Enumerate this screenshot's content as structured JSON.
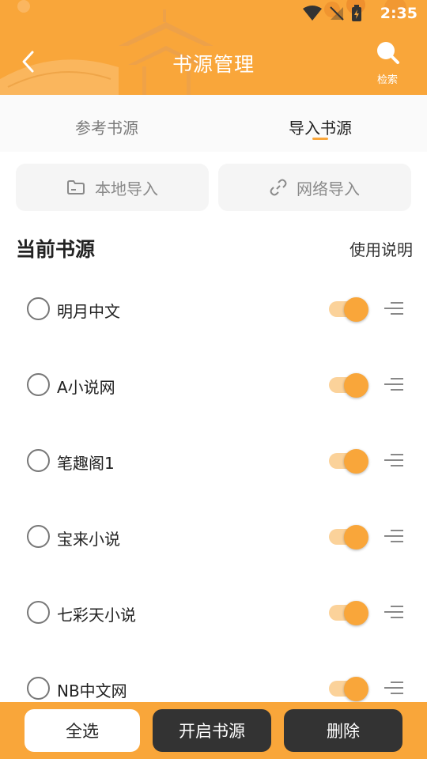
{
  "status_bar": {
    "time": "2:35"
  },
  "header": {
    "title": "书源管理",
    "search_label": "检索"
  },
  "tabs": [
    {
      "label": "参考书源",
      "active": false
    },
    {
      "label": "导入书源",
      "active": true
    }
  ],
  "import": {
    "local_label": "本地导入",
    "network_label": "网络导入"
  },
  "section": {
    "title": "当前书源",
    "help_label": "使用说明"
  },
  "sources": [
    {
      "name": "明月中文",
      "enabled": true
    },
    {
      "name": "A小说网",
      "enabled": true
    },
    {
      "name": "笔趣阁1",
      "enabled": true
    },
    {
      "name": "宝来小说",
      "enabled": true
    },
    {
      "name": "七彩天小说",
      "enabled": true
    },
    {
      "name": "NB中文网",
      "enabled": true
    }
  ],
  "bottom_bar": {
    "select_all_label": "全选",
    "enable_label": "开启书源",
    "delete_label": "删除"
  },
  "colors": {
    "accent": "#f9a63a",
    "dark_button": "#333333",
    "toggle_track": "#fbd29a"
  }
}
